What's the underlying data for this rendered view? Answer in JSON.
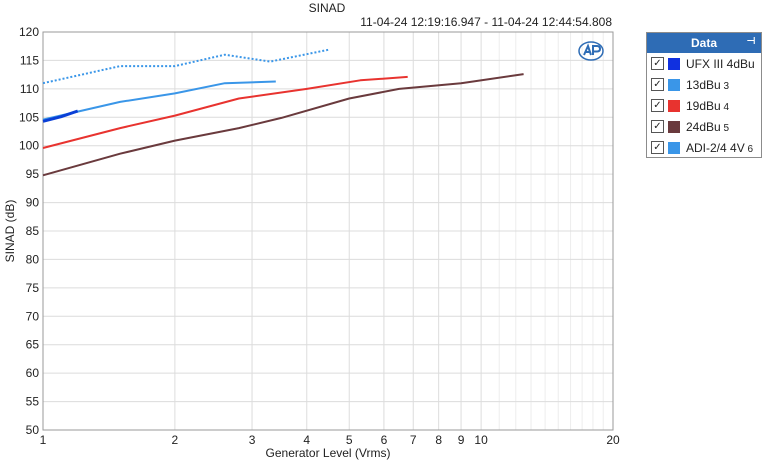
{
  "chart_data": {
    "type": "line",
    "title": "SINAD",
    "subtitle": "11-04-24 12:19:16.947 - 11-04-24 12:44:54.808",
    "xlabel": "Generator Level (Vrms)",
    "ylabel": "SINAD (dB)",
    "x_scale": "log",
    "xlim": [
      1,
      20
    ],
    "ylim": [
      50,
      120
    ],
    "x_ticks": [
      1,
      2,
      3,
      4,
      5,
      6,
      7,
      8,
      9,
      10,
      20
    ],
    "y_ticks": [
      50,
      55,
      60,
      65,
      70,
      75,
      80,
      85,
      90,
      95,
      100,
      105,
      110,
      115,
      120
    ],
    "grid": true,
    "legend_title": "Data",
    "legend_position": "right",
    "series": [
      {
        "name": "UFX III 4dBu",
        "channel": "",
        "color": "#0a3fd6",
        "dash": "solid",
        "width": 3,
        "x": [
          1.0,
          1.1,
          1.2
        ],
        "y": [
          104.3,
          105.1,
          106.1
        ]
      },
      {
        "name": "13dBu",
        "channel": "3",
        "color": "#3a96e8",
        "dash": "solid",
        "width": 2,
        "x": [
          1.0,
          1.2,
          1.5,
          2.0,
          2.6,
          3.4
        ],
        "y": [
          104.6,
          106.0,
          107.7,
          109.2,
          111.0,
          111.3
        ]
      },
      {
        "name": "19dBu",
        "channel": "4",
        "color": "#e8332f",
        "dash": "solid",
        "width": 2,
        "x": [
          1.0,
          1.5,
          2.0,
          2.8,
          4.0,
          5.3,
          6.8
        ],
        "y": [
          99.6,
          103.1,
          105.3,
          108.3,
          110.0,
          111.5,
          112.1
        ]
      },
      {
        "name": "24dBu",
        "channel": "5",
        "color": "#6a3a3d",
        "dash": "solid",
        "width": 2,
        "x": [
          1.0,
          1.5,
          2.0,
          2.8,
          3.5,
          5.0,
          6.5,
          9.0,
          12.5
        ],
        "y": [
          94.8,
          98.6,
          100.9,
          103.1,
          104.9,
          108.3,
          110.0,
          111.0,
          112.6
        ]
      },
      {
        "name": "ADI-2/4 4V",
        "channel": "6",
        "color": "#3a96e8",
        "dash": "dotted",
        "width": 2,
        "x": [
          1.0,
          1.5,
          2.0,
          2.6,
          3.3,
          4.5
        ],
        "y": [
          111.0,
          114.0,
          114.0,
          116.0,
          114.8,
          116.9
        ]
      }
    ]
  }
}
